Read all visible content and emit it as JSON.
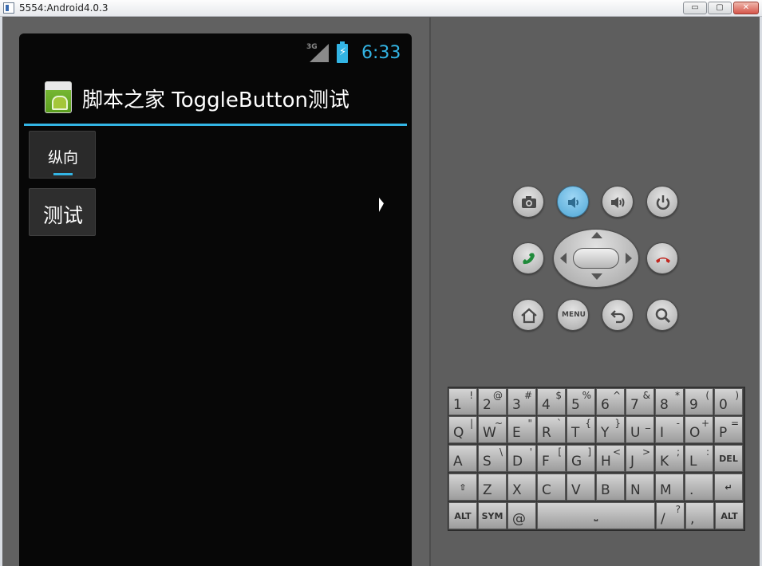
{
  "window": {
    "title": "5554:Android4.0.3",
    "min_label": "▭",
    "max_label": "▢",
    "close_label": "✕"
  },
  "status_bar": {
    "network": "3G",
    "battery_glyph": "⚡",
    "time": "6:33"
  },
  "app": {
    "title": "脚本之家 ToggleButton测试"
  },
  "toggle_button": {
    "label": "纵向"
  },
  "test_button": {
    "label": "测试"
  },
  "controls": {
    "menu_label": "MENU",
    "icons": [
      "camera-icon",
      "volume-down-icon",
      "volume-up-icon",
      "power-icon",
      "call-icon",
      "end-call-icon",
      "home-icon",
      "menu-icon",
      "back-icon",
      "search-icon"
    ]
  },
  "keyboard": {
    "rows": [
      [
        {
          "m": "1",
          "s": "!"
        },
        {
          "m": "2",
          "s": "@"
        },
        {
          "m": "3",
          "s": "#"
        },
        {
          "m": "4",
          "s": "$"
        },
        {
          "m": "5",
          "s": "%"
        },
        {
          "m": "6",
          "s": "^"
        },
        {
          "m": "7",
          "s": "&"
        },
        {
          "m": "8",
          "s": "*"
        },
        {
          "m": "9",
          "s": "("
        },
        {
          "m": "0",
          "s": ")"
        }
      ],
      [
        {
          "m": "Q",
          "s": "|"
        },
        {
          "m": "W",
          "s": "~"
        },
        {
          "m": "E",
          "s": "\""
        },
        {
          "m": "R",
          "s": "`"
        },
        {
          "m": "T",
          "s": "{"
        },
        {
          "m": "Y",
          "s": "}"
        },
        {
          "m": "U",
          "s": "_"
        },
        {
          "m": "I",
          "s": "-"
        },
        {
          "m": "O",
          "s": "+"
        },
        {
          "m": "P",
          "s": "="
        }
      ],
      [
        {
          "m": "A",
          "s": ""
        },
        {
          "m": "S",
          "s": "\\"
        },
        {
          "m": "D",
          "s": "'"
        },
        {
          "m": "F",
          "s": "["
        },
        {
          "m": "G",
          "s": "]"
        },
        {
          "m": "H",
          "s": "<"
        },
        {
          "m": "J",
          "s": ">"
        },
        {
          "m": "K",
          "s": ";"
        },
        {
          "m": "L",
          "s": ":"
        },
        {
          "m": "",
          "s": "",
          "c": "DEL"
        }
      ],
      [
        {
          "m": "",
          "s": "",
          "c": "⇧"
        },
        {
          "m": "Z",
          "s": ""
        },
        {
          "m": "X",
          "s": ""
        },
        {
          "m": "C",
          "s": ""
        },
        {
          "m": "V",
          "s": ""
        },
        {
          "m": "B",
          "s": ""
        },
        {
          "m": "N",
          "s": ""
        },
        {
          "m": "M",
          "s": ""
        },
        {
          "m": ".",
          "s": ""
        },
        {
          "m": "",
          "s": "",
          "c": "↵"
        }
      ]
    ],
    "bottom": {
      "alt": "ALT",
      "sym": "SYM",
      "at": "@",
      "space": "⎵",
      "slash": "/",
      "question": "?",
      "comma": ",",
      "alt_right": "ALT"
    }
  }
}
